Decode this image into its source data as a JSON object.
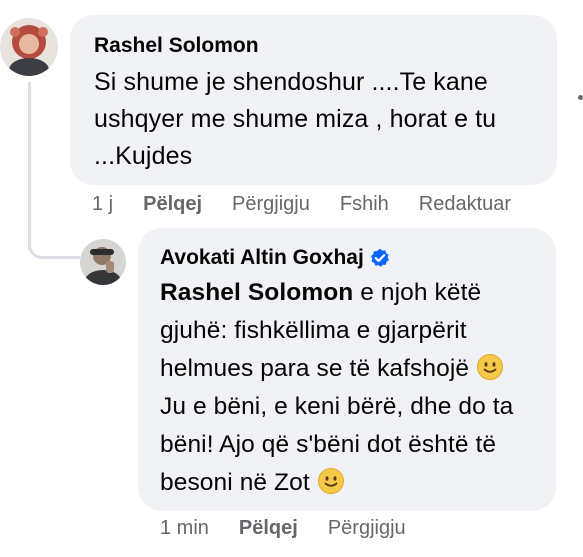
{
  "comments": [
    {
      "author": "Rashel Solomon",
      "text": "Si shume je shendoshur ....Te kane ushqyer me shume miza , horat e tu ...Kujdes",
      "actions": {
        "time": "1 j",
        "like": "Pëlqej",
        "reply": "Përgjigju",
        "hide": "Fshih",
        "edited": "Redaktuar"
      }
    },
    {
      "author": "Avokati Altin Goxhaj",
      "verified": true,
      "mention": "Rashel Solomon",
      "text_part1": " e njoh këtë gjuhë: fishkëllima e gjarpërit helmues para se të kafshojë ",
      "text_part2": " Ju e bëni, e keni bërë, dhe do ta bëni! Ajo që s'bëni dot është të besoni në Zot ",
      "emoji": "slightly-smiling-face",
      "actions": {
        "time": "1 min",
        "like": "Pëlqej",
        "reply": "Përgjigju"
      }
    }
  ],
  "colors": {
    "bubble": "#f0f2f5",
    "meta_text": "#65676b",
    "verified": "#0866ff",
    "thread_line": "#dcdfe3"
  }
}
